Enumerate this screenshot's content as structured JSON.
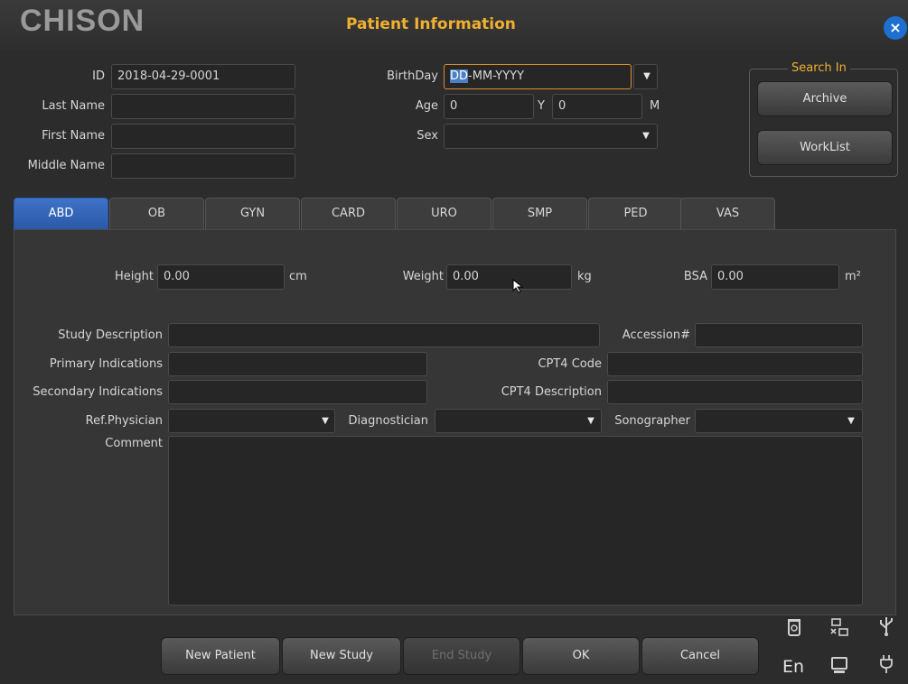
{
  "header": {
    "logo": "CHISON",
    "title": "Patient Information",
    "close_label": "×"
  },
  "patient": {
    "id_label": "ID",
    "id_value": "2018-04-29-0001",
    "last_name_label": "Last Name",
    "last_name_value": "",
    "first_name_label": "First Name",
    "first_name_value": "",
    "middle_name_label": "Middle Name",
    "middle_name_value": "",
    "birthday_label": "BirthDay",
    "birthday_selected": "DD",
    "birthday_rest": "-MM-YYYY",
    "age_label": "Age",
    "age_years": "0",
    "age_y_unit": "Y",
    "age_months": "0",
    "age_m_unit": "M",
    "sex_label": "Sex",
    "sex_value": ""
  },
  "search": {
    "legend": "Search In",
    "archive_label": "Archive",
    "worklist_label": "WorkList"
  },
  "tabs": [
    {
      "label": "ABD",
      "active": true
    },
    {
      "label": "OB"
    },
    {
      "label": "GYN"
    },
    {
      "label": "CARD"
    },
    {
      "label": "URO"
    },
    {
      "label": "SMP"
    },
    {
      "label": "PED"
    },
    {
      "label": "VAS"
    }
  ],
  "measure": {
    "height_label": "Height",
    "height_value": "0.00",
    "height_unit": "cm",
    "weight_label": "Weight",
    "weight_value": "0.00",
    "weight_unit": "kg",
    "bsa_label": "BSA",
    "bsa_value": "0.00",
    "bsa_unit": "m²"
  },
  "study": {
    "description_label": "Study Description",
    "accession_label": "Accession#",
    "primary_label": "Primary Indications",
    "cpt4_code_label": "CPT4 Code",
    "secondary_label": "Secondary Indications",
    "cpt4_desc_label": "CPT4 Description",
    "ref_physician_label": "Ref.Physician",
    "diagnostician_label": "Diagnostician",
    "sonographer_label": "Sonographer",
    "comment_label": "Comment"
  },
  "footer": {
    "new_patient": "New Patient",
    "new_study": "New Study",
    "end_study": "End Study",
    "ok": "OK",
    "cancel": "Cancel",
    "language": "En"
  },
  "icons": [
    "recycle-bin-icon",
    "network-icon",
    "usb-icon",
    "display-icon",
    "power-plug-icon"
  ],
  "colors": {
    "accent_orange": "#f0b030",
    "tab_active_blue": "#2f63b8",
    "close_blue": "#1e6fd0"
  }
}
